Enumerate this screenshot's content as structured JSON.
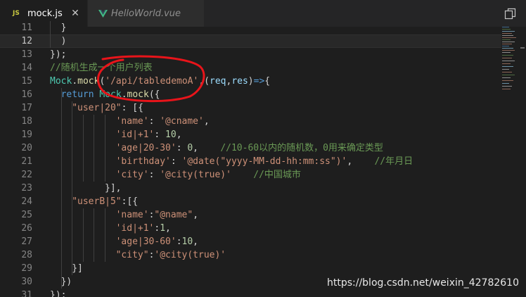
{
  "tabs": [
    {
      "icon": "js-icon",
      "badge": "JS",
      "label": "mock.js",
      "active": true,
      "close_glyph": "✕"
    },
    {
      "icon": "vue-icon",
      "label": "HelloWorld.vue",
      "active": false
    }
  ],
  "editor": {
    "current_line": 12,
    "lines": [
      {
        "number": "11",
        "tokens": [
          {
            "t": "}",
            "c": "p"
          }
        ]
      },
      {
        "number": "12",
        "tokens": [
          {
            "t": ")",
            "c": "p"
          }
        ]
      },
      {
        "number": "13",
        "tokens": [
          {
            "t": "});",
            "c": "p"
          }
        ]
      },
      {
        "number": "14",
        "tokens": [
          {
            "t": "//随机生成一个用户列表",
            "c": "c"
          }
        ]
      },
      {
        "number": "15",
        "tokens": [
          {
            "t": "Mock",
            "c": "t"
          },
          {
            "t": ".",
            "c": "p"
          },
          {
            "t": "mock",
            "c": "f"
          },
          {
            "t": "(",
            "c": "p"
          },
          {
            "t": "'/api/tabledemoA'",
            "c": "s"
          },
          {
            "t": ",(",
            "c": "p"
          },
          {
            "t": "req",
            "c": "v"
          },
          {
            "t": ",",
            "c": "p"
          },
          {
            "t": "res",
            "c": "v"
          },
          {
            "t": ")",
            "c": "p"
          },
          {
            "t": "=>",
            "c": "k"
          },
          {
            "t": "{",
            "c": "p"
          }
        ]
      },
      {
        "number": "16",
        "tokens": [
          {
            "t": "return ",
            "c": "k"
          },
          {
            "t": "Mock",
            "c": "t"
          },
          {
            "t": ".",
            "c": "p"
          },
          {
            "t": "mock",
            "c": "f"
          },
          {
            "t": "({",
            "c": "p"
          }
        ]
      },
      {
        "number": "17",
        "tokens": [
          {
            "t": "\"user|20\"",
            "c": "s"
          },
          {
            "t": ": [{",
            "c": "p"
          }
        ]
      },
      {
        "number": "18",
        "tokens": [
          {
            "t": "'name'",
            "c": "s"
          },
          {
            "t": ": ",
            "c": "p"
          },
          {
            "t": "'@cname'",
            "c": "s"
          },
          {
            "t": ",",
            "c": "p"
          }
        ]
      },
      {
        "number": "19",
        "tokens": [
          {
            "t": "'id|+1'",
            "c": "s"
          },
          {
            "t": ": ",
            "c": "p"
          },
          {
            "t": "10",
            "c": "n"
          },
          {
            "t": ",",
            "c": "p"
          }
        ]
      },
      {
        "number": "20",
        "tokens": [
          {
            "t": "'age|20-30'",
            "c": "s"
          },
          {
            "t": ": ",
            "c": "p"
          },
          {
            "t": "0",
            "c": "n"
          },
          {
            "t": ",    ",
            "c": "p"
          },
          {
            "t": "//10-60以内的随机数，0用来确定类型",
            "c": "c"
          }
        ]
      },
      {
        "number": "21",
        "tokens": [
          {
            "t": "'birthday'",
            "c": "s"
          },
          {
            "t": ": ",
            "c": "p"
          },
          {
            "t": "'@date(\"yyyy-MM-dd-hh:mm:ss\")'",
            "c": "s"
          },
          {
            "t": ",    ",
            "c": "p"
          },
          {
            "t": "//年月日",
            "c": "c"
          }
        ]
      },
      {
        "number": "22",
        "tokens": [
          {
            "t": "'city'",
            "c": "s"
          },
          {
            "t": ": ",
            "c": "p"
          },
          {
            "t": "'@city(true)'",
            "c": "s"
          },
          {
            "t": "    ",
            "c": "p"
          },
          {
            "t": "//中国城市",
            "c": "c"
          }
        ]
      },
      {
        "number": "23",
        "tokens": [
          {
            "t": "}],",
            "c": "p"
          }
        ]
      },
      {
        "number": "24",
        "tokens": [
          {
            "t": "\"userB|5\"",
            "c": "s"
          },
          {
            "t": ":[{",
            "c": "p"
          }
        ]
      },
      {
        "number": "25",
        "tokens": [
          {
            "t": "'name'",
            "c": "s"
          },
          {
            "t": ":",
            "c": "p"
          },
          {
            "t": "\"@name\"",
            "c": "s"
          },
          {
            "t": ",",
            "c": "p"
          }
        ]
      },
      {
        "number": "26",
        "tokens": [
          {
            "t": "'id|+1'",
            "c": "s"
          },
          {
            "t": ":",
            "c": "p"
          },
          {
            "t": "1",
            "c": "n"
          },
          {
            "t": ",",
            "c": "p"
          }
        ]
      },
      {
        "number": "27",
        "tokens": [
          {
            "t": "'age|30-60'",
            "c": "s"
          },
          {
            "t": ":",
            "c": "p"
          },
          {
            "t": "10",
            "c": "n"
          },
          {
            "t": ",",
            "c": "p"
          }
        ]
      },
      {
        "number": "28",
        "tokens": [
          {
            "t": "\"city\"",
            "c": "s"
          },
          {
            "t": ":",
            "c": "p"
          },
          {
            "t": "'@city(true)'",
            "c": "s"
          }
        ]
      },
      {
        "number": "29",
        "tokens": [
          {
            "t": "}]",
            "c": "p"
          }
        ]
      },
      {
        "number": "30",
        "tokens": [
          {
            "t": "})",
            "c": "p"
          }
        ]
      },
      {
        "number": "31",
        "tokens": [
          {
            "t": "});",
            "c": "p"
          }
        ]
      }
    ]
  },
  "colors": {
    "annotation": "#e8141a",
    "background": "#1e1e1e",
    "tabbar": "#252526"
  },
  "watermark": "https://blog.csdn.net/weixin_42782610"
}
